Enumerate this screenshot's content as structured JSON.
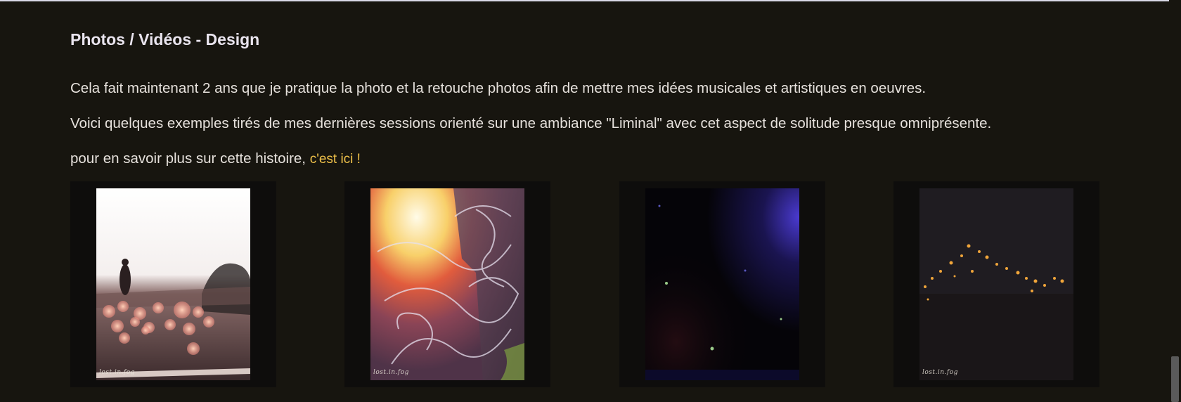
{
  "section": {
    "title": "Photos / Vidéos - Design",
    "paragraph_1": "Cela fait maintenant 2 ans que je pratique la photo et la retouche photos afin de mettre mes idées musicales et artistiques en oeuvres.",
    "paragraph_2": "Voici quelques exemples tirés de mes dernières sessions orienté sur une ambiance \"Liminal\" avec cet aspect de solitude presque omniprésente.",
    "paragraph_3_prefix": "pour en savoir plus sur cette histoire, ",
    "link_label": "c'est ici !"
  },
  "gallery": {
    "photos": [
      {
        "watermark": "lost.in.fog",
        "description_icon": "silhouette-bokeh-photo"
      },
      {
        "watermark": "lost.in.fog",
        "description_icon": "light-leak-scribbles-photo"
      },
      {
        "watermark": "",
        "description_icon": "dark-space-photo"
      },
      {
        "watermark": "lost.in.fog",
        "description_icon": "city-lights-bokeh-photo"
      }
    ]
  },
  "colors": {
    "background": "#17150f",
    "link": "#f0c24a",
    "text": "#e6e1dc"
  }
}
